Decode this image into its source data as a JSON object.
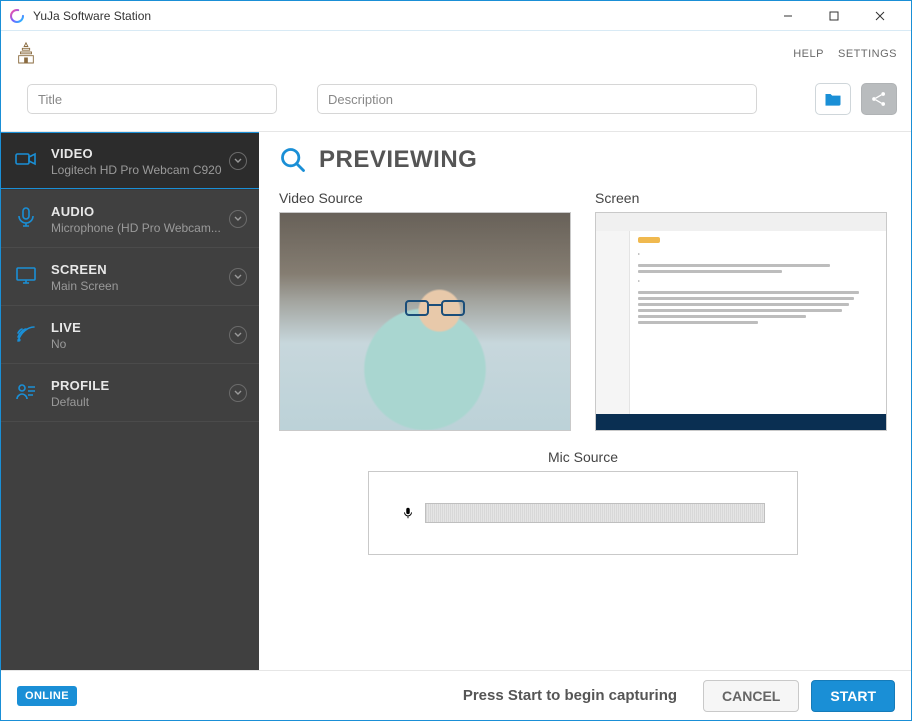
{
  "window": {
    "title": "YuJa Software Station"
  },
  "header": {
    "help_label": "HELP",
    "settings_label": "SETTINGS"
  },
  "inputs": {
    "title_placeholder": "Title",
    "title_value": "",
    "description_placeholder": "Description",
    "description_value": ""
  },
  "sidebar": {
    "items": [
      {
        "icon": "video",
        "label": "VIDEO",
        "sub": "Logitech HD Pro Webcam C920",
        "active": true
      },
      {
        "icon": "audio",
        "label": "AUDIO",
        "sub": "Microphone (HD Pro Webcam...",
        "active": false
      },
      {
        "icon": "screen",
        "label": "SCREEN",
        "sub": "Main Screen",
        "active": false
      },
      {
        "icon": "live",
        "label": "LIVE",
        "sub": "No",
        "active": false
      },
      {
        "icon": "profile",
        "label": "PROFILE",
        "sub": "Default",
        "active": false
      }
    ]
  },
  "preview": {
    "heading": "PREVIEWING",
    "video_source_label": "Video Source",
    "screen_label": "Screen",
    "mic_source_label": "Mic Source"
  },
  "footer": {
    "status_badge": "ONLINE",
    "hint": "Press Start to begin capturing",
    "cancel_label": "CANCEL",
    "start_label": "START"
  },
  "colors": {
    "accent": "#1a8fd6",
    "sidebar_bg": "#404040"
  }
}
